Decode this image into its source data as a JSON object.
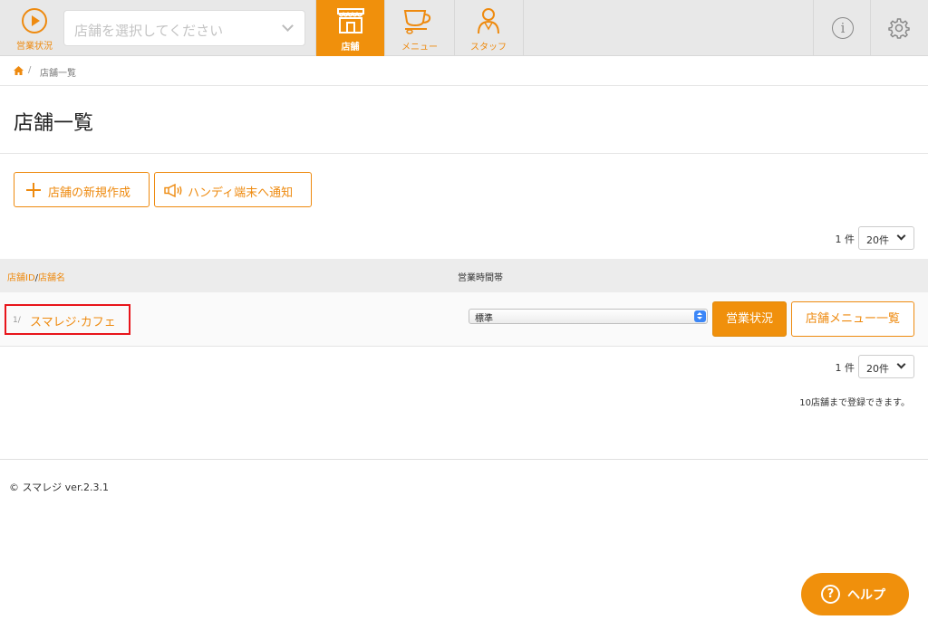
{
  "header": {
    "status_label": "営業状況",
    "store_select_placeholder": "店舗を選択してください",
    "tabs": [
      {
        "label": "店舗",
        "active": true
      },
      {
        "label": "メニュー",
        "active": false
      },
      {
        "label": "スタッフ",
        "active": false
      }
    ]
  },
  "breadcrumb": {
    "separator": "/",
    "current": "店舗一覧"
  },
  "page_title": "店舗一覧",
  "actions": {
    "new_store_label": "店舗の新規作成",
    "notify_label": "ハンディ端末へ通知"
  },
  "pager": {
    "count_label": "1 件",
    "per_page": "20件"
  },
  "table": {
    "headers": {
      "store_id": "店舗ID",
      "slash": "/",
      "store_name": "店舗名",
      "hours": "営業時間帯"
    },
    "rows": [
      {
        "id": "1/",
        "name": "スマレジ·カフェ",
        "hours_value": "標準",
        "status_button": "営業状況",
        "menu_button": "店舗メニュー一覧"
      }
    ]
  },
  "limit_note": "10店舗まで登録できます。",
  "footer": {
    "copyright": "© スマレジ ver.2.3.1"
  },
  "help": {
    "icon": "?",
    "label": "ヘルプ"
  },
  "colors": {
    "accent": "#f0900c",
    "highlight_border": "#e8151b"
  }
}
